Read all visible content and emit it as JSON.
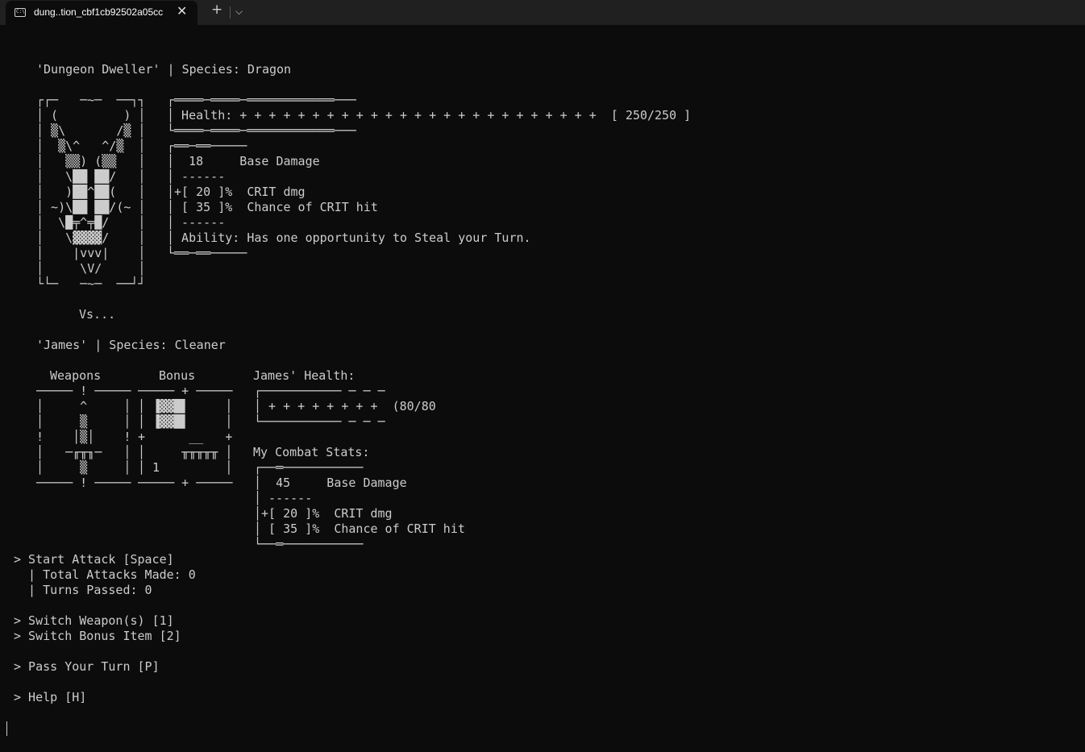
{
  "window": {
    "tab_title": "dung..tion_cbf1cb92502a05cc",
    "tab_icon": "terminal-icon",
    "close_glyph": "✕",
    "new_tab_glyph": "+",
    "dropdown_glyph": "⌵"
  },
  "terminal": {
    "enemy_header": "'Dungeon Dweller' | Species: Dragon",
    "dragon_art": "┌┌─   ─~─  ──┐┐\n│ (         ) │\n│ ▒\\       /▒ │\n│  ▒\\^   ^/▒  │\n│   ▒▒) (▒▒   │\n│   \\██ ██/   │\n│   )██^██(   │\n│ ~)\\██ ██/(~ │\n│  \\█╤^╤█/    │\n│   \\▓▓▓▓/    │\n│    |vvv|    │\n│     \\V/     │\n└└─   ─~─  ──┘┘",
    "enemy_health_box": "┌════─════─════════════───\n│ Health: + + + + + + + + + + + + + + + + + + + + + + + + +  [ 250/250 ]\n└════─════─════════════───",
    "enemy_stats_box": "┌══─══─────\n│  18     Base Damage\n│ ------\n│+[ 20 ]%  CRIT dmg\n│ [ 35 ]%  Chance of CRIT hit\n│ ------\n│ Ability: Has one opportunity to Steal your Turn.\n└══─══─────",
    "vs_text": "Vs...",
    "player_header": "'James' | Species: Cleaner",
    "weapons_label": "Weapons",
    "weapons_art": "───── ! ─────\n│     ^     │\n│     ▒     │\n!    │▒│    !\n│   ─╓╥╖─   │\n│     ▒     │\n───── ! ─────",
    "bonus_label": "Bonus",
    "bonus_art": "───── + ─────\n│ ▐▓▓█▌     │\n│ ▐▓▓█▌     │\n+      __   +\n│     ╥╥╥╥╥ │\n│ 1         │\n───── + ─────",
    "player_health_label": "James' Health:",
    "player_health_box": "┌─────────── ─ ─ ─\n│ + + + + + + + +  (80/80\n└─────────── ─ ─ ─",
    "combat_stats_label": "My Combat Stats:",
    "player_stats_box": "┌──═───────────\n│  45     Base Damage\n│ ------\n│+[ 20 ]%  CRIT dmg\n│ [ 35 ]%  Chance of CRIT hit\n└──═───────────",
    "menu": {
      "start_attack": "> Start Attack [Space]",
      "total_attacks": "  | Total Attacks Made: 0",
      "turns_passed": "  | Turns Passed: 0",
      "switch_weapon": "> Switch Weapon(s) [1]",
      "switch_bonus": "> Switch Bonus Item [2]",
      "pass_turn": "> Pass Your Turn [P]",
      "help": "> Help [H]"
    }
  }
}
